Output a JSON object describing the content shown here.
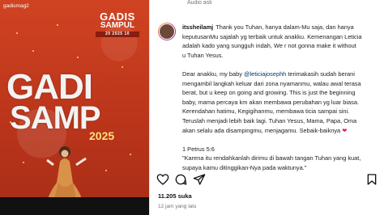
{
  "media": {
    "watermark": "gadismag2",
    "logo": {
      "line1": "GADIS",
      "line2": "SAMPUL",
      "line3": "20 2025 10"
    },
    "screen_line1": "GADI",
    "screen_line2": "SAMP",
    "screen_year": "2025"
  },
  "post": {
    "audio_label": "Audio asli",
    "username": "itssheilamj",
    "caption": {
      "line1": "Thank you Tuhan, hanya dalam-Mu saja, dan hanya",
      "line2": "keputusanMu sajalah yg terbaik untuk anakku. Kemenangan Leticia",
      "line3": "adalah kado yang sungguh indah, We r not gonna make it without",
      "line4": "u Tuhan Yesus.",
      "line5a": "Dear anakku, my baby ",
      "mention": "@leticiajosephh",
      "line5b": " terimakasih sudah berani",
      "line6": "mengambil langkah keluar dari zona nyamanmu, walau awal terasa",
      "line7": "berat, but u keep on going and growing. This is just the beginning",
      "line8": "baby, mama percaya km akan membawa perubahan yg luar biasa.",
      "line9": "Kerendahan hatimu, Kegigihanmu, membawa ticia sampai sini.",
      "line10": "Teruslah menjadi lebih baik lagi. Tuhan Yesus, Mama, Papa, Oma",
      "line11": "akan selalu ada disampingmu, menjagamu. Sebaik-baiknya",
      "verse_ref": "1 Petrus 5:6",
      "verse1": "\"Karena itu rendahkanlah dirimu di bawah tangan Tuhan yang kuat,",
      "verse2": "supaya kamu ditinggikan-Nya pada waktunya.\""
    },
    "likes": "11.205 suka",
    "time": "12 jam yang lalu"
  },
  "icons": {
    "heart": "heart-icon",
    "comment": "comment-icon",
    "share": "share-icon",
    "save": "bookmark-icon"
  },
  "colors": {
    "media_bg": "#c63a1e",
    "mention": "#00376b",
    "heart": "#e0245e",
    "muted": "#737373"
  }
}
